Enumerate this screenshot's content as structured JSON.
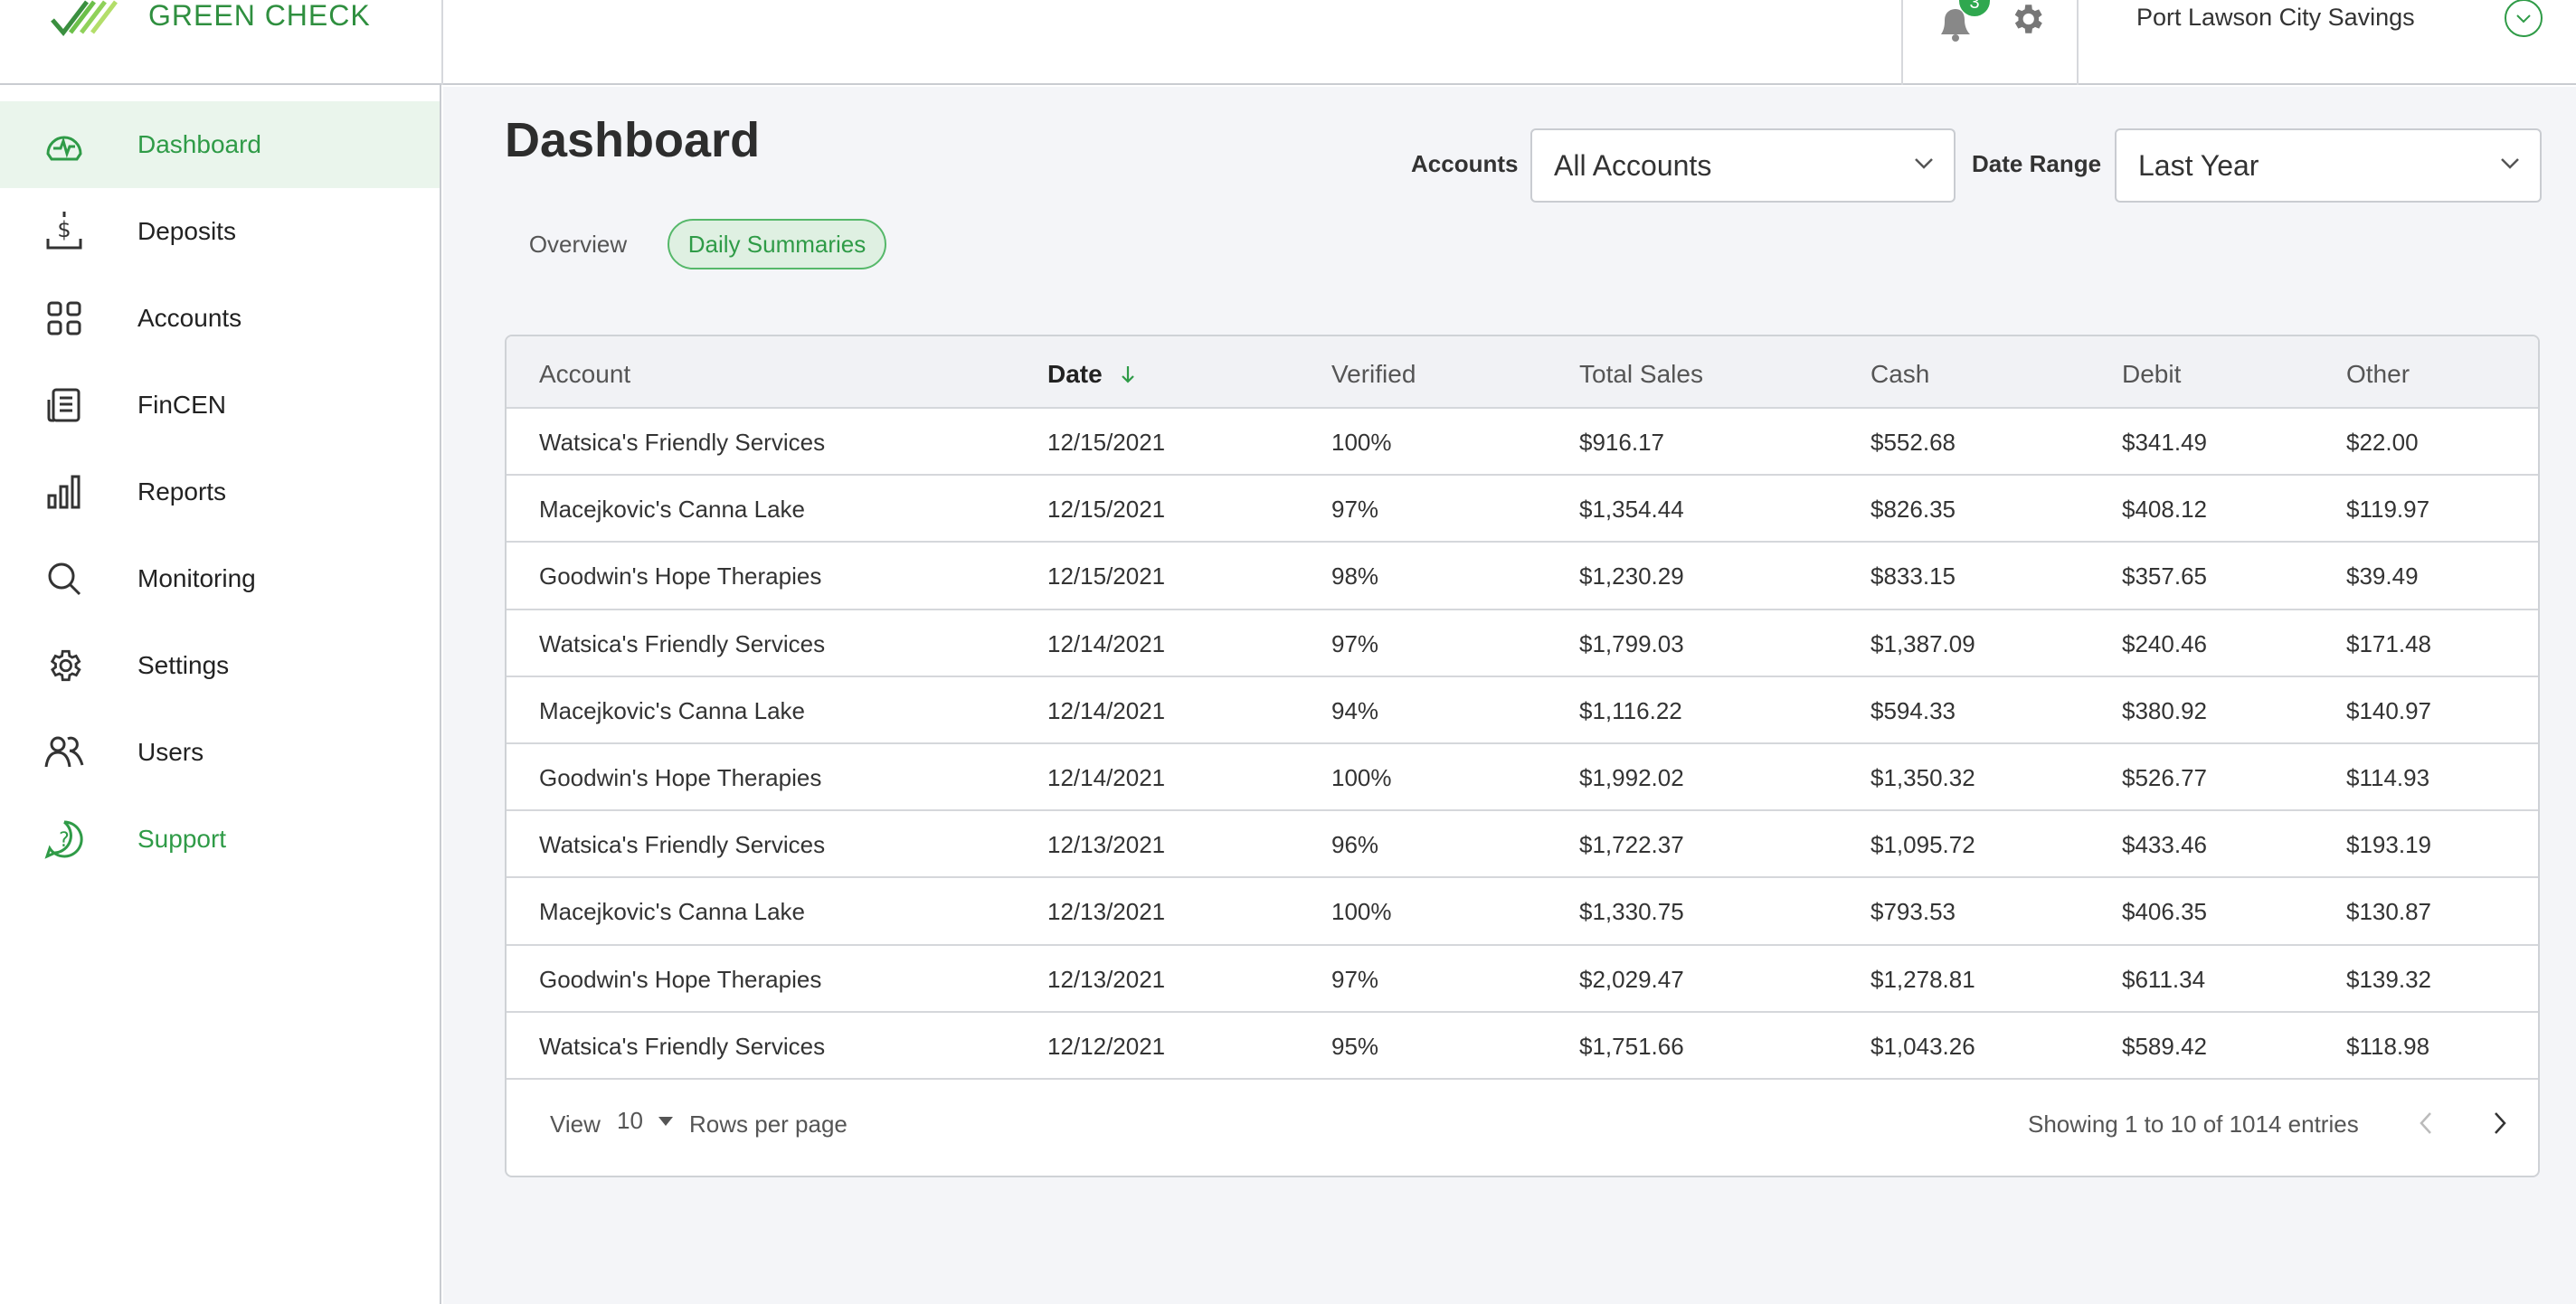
{
  "brand": {
    "logo_text": "GREEN CHECK"
  },
  "header": {
    "notification_count": "3",
    "org_name": "Port Lawson City Savings"
  },
  "sidebar": {
    "items": [
      {
        "label": "Dashboard",
        "icon": "dashboard-icon"
      },
      {
        "label": "Deposits",
        "icon": "deposit-icon"
      },
      {
        "label": "Accounts",
        "icon": "grid-icon"
      },
      {
        "label": "FinCEN",
        "icon": "document-icon"
      },
      {
        "label": "Reports",
        "icon": "bar-chart-icon"
      },
      {
        "label": "Monitoring",
        "icon": "search-icon"
      },
      {
        "label": "Settings",
        "icon": "gear-icon"
      },
      {
        "label": "Users",
        "icon": "users-icon"
      },
      {
        "label": "Support",
        "icon": "help-icon"
      }
    ]
  },
  "page": {
    "title": "Dashboard"
  },
  "filters": {
    "accounts_label": "Accounts",
    "accounts_value": "All Accounts",
    "date_range_label": "Date Range",
    "date_range_value": "Last Year"
  },
  "tabs": [
    {
      "label": "Overview",
      "active": false
    },
    {
      "label": "Daily Summaries",
      "active": true
    }
  ],
  "table": {
    "columns": [
      "Account",
      "Date",
      "Verified",
      "Total Sales",
      "Cash",
      "Debit",
      "Other"
    ],
    "sort_column": "Date",
    "rows": [
      [
        "Watsica's Friendly Services",
        "12/15/2021",
        "100%",
        "$916.17",
        "$552.68",
        "$341.49",
        "$22.00"
      ],
      [
        "Macejkovic's Canna Lake",
        "12/15/2021",
        "97%",
        "$1,354.44",
        "$826.35",
        "$408.12",
        "$119.97"
      ],
      [
        "Goodwin's Hope Therapies",
        "12/15/2021",
        "98%",
        "$1,230.29",
        "$833.15",
        "$357.65",
        "$39.49"
      ],
      [
        "Watsica's Friendly Services",
        "12/14/2021",
        "97%",
        "$1,799.03",
        "$1,387.09",
        "$240.46",
        "$171.48"
      ],
      [
        "Macejkovic's Canna Lake",
        "12/14/2021",
        "94%",
        "$1,116.22",
        "$594.33",
        "$380.92",
        "$140.97"
      ],
      [
        "Goodwin's Hope Therapies",
        "12/14/2021",
        "100%",
        "$1,992.02",
        "$1,350.32",
        "$526.77",
        "$114.93"
      ],
      [
        "Watsica's Friendly Services",
        "12/13/2021",
        "96%",
        "$1,722.37",
        "$1,095.72",
        "$433.46",
        "$193.19"
      ],
      [
        "Macejkovic's Canna Lake",
        "12/13/2021",
        "100%",
        "$1,330.75",
        "$793.53",
        "$406.35",
        "$130.87"
      ],
      [
        "Goodwin's Hope Therapies",
        "12/13/2021",
        "97%",
        "$2,029.47",
        "$1,278.81",
        "$611.34",
        "$139.32"
      ],
      [
        "Watsica's Friendly Services",
        "12/12/2021",
        "95%",
        "$1,751.66",
        "$1,043.26",
        "$589.42",
        "$118.98"
      ]
    ]
  },
  "pagination": {
    "view_label": "View",
    "rows_per_page": "10",
    "rows_per_page_label": "Rows per page",
    "showing_text": "Showing 1 to 10 of 1014 entries"
  },
  "colors": {
    "accent": "#2f9b47",
    "active_bg": "#eaf5ec",
    "page_bg": "#f4f5f8"
  }
}
